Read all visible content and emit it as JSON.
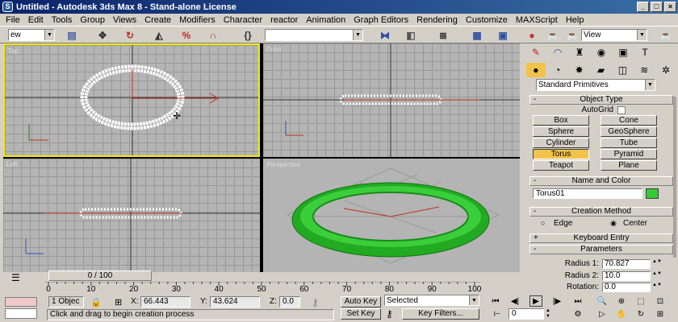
{
  "window": {
    "title": "Untitled   - Autodesk 3ds Max 8   - Stand-alone License"
  },
  "menu": [
    "File",
    "Edit",
    "Tools",
    "Group",
    "Views",
    "Create",
    "Modifiers",
    "Character",
    "reactor",
    "Animation",
    "Graph Editors",
    "Rendering",
    "Customize",
    "MAXScript",
    "Help"
  ],
  "toolbar": {
    "selection_filter": "ew",
    "view_dropdown": "View",
    "named_selection": ""
  },
  "viewports": {
    "top": "Top",
    "front": "Front",
    "left": "Left",
    "perspective": "Perspective"
  },
  "command_panel": {
    "category_dropdown": "Standard Primitives",
    "object_type": {
      "title": "Object Type",
      "autogrid_label": "AutoGrid",
      "buttons": [
        "Box",
        "Cone",
        "Sphere",
        "GeoSphere",
        "Cylinder",
        "Tube",
        "Torus",
        "Pyramid",
        "Teapot",
        "Plane"
      ],
      "active": "Torus"
    },
    "name_and_color": {
      "title": "Name and Color",
      "name": "Torus01",
      "color": "#33cc33"
    },
    "creation_method": {
      "title": "Creation Method",
      "edge": "Edge",
      "center": "Center",
      "selected": "Center"
    },
    "keyboard_entry": {
      "title": "Keyboard Entry"
    },
    "parameters": {
      "title": "Parameters",
      "radius1_label": "Radius 1:",
      "radius1": "70.827",
      "radius2_label": "Radius 2:",
      "radius2": "10.0",
      "rotation_label": "Rotation:",
      "rotation": "0.0"
    }
  },
  "timeline": {
    "slider": "0 / 100",
    "ticks": [
      "0",
      "10",
      "20",
      "30",
      "40",
      "50",
      "60",
      "70",
      "80",
      "90",
      "100"
    ]
  },
  "status": {
    "selection_count": "1 Objec",
    "x_label": "X:",
    "x": "66.443",
    "y_label": "Y:",
    "y": "43.624",
    "z_label": "Z:",
    "z": "0.0",
    "prompt": "Click and drag to begin creation process",
    "auto_key": "Auto Key",
    "set_key": "Set Key",
    "key_mode": "Selected",
    "key_filters": "Key Filters...",
    "frame": "0"
  },
  "colors": {
    "active_viewport": "#f7e800",
    "torus": "#33cc33",
    "active_button": "#f2c34a"
  }
}
